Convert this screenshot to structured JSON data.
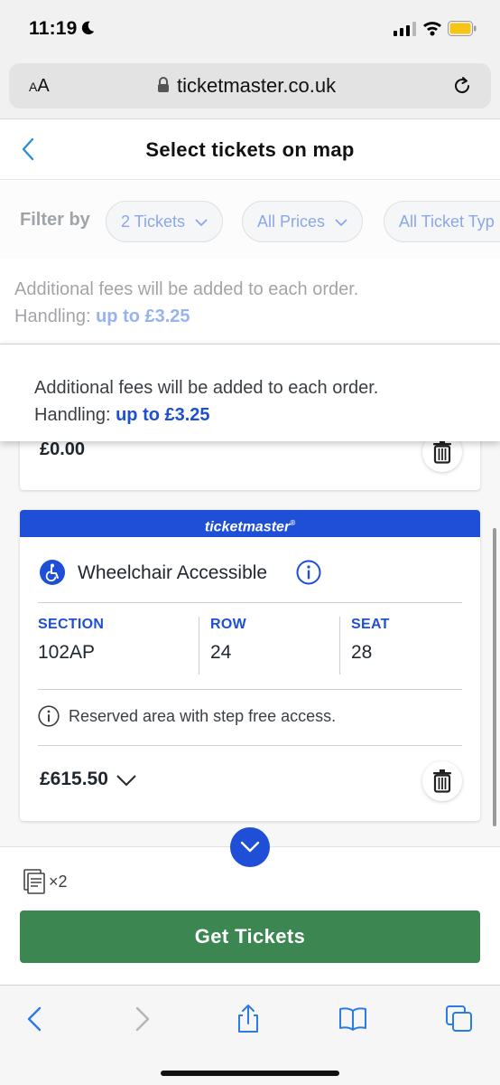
{
  "status_bar": {
    "time": "11:19"
  },
  "browser": {
    "text_size_label_small": "A",
    "text_size_label_large": "A",
    "url": "ticketmaster.co.uk"
  },
  "header": {
    "title": "Select tickets on map"
  },
  "filters": {
    "label": "Filter by",
    "chips": [
      "2 Tickets",
      "All Prices",
      "All Ticket Typ"
    ]
  },
  "fees_notice": {
    "line1": "Additional fees will be added to each order.",
    "handling_label": "Handling:",
    "handling_value": "up to £3.25"
  },
  "previous_ticket": {
    "price": "£0.00"
  },
  "ticket": {
    "brand": "ticketmaster",
    "brand_mark": "®",
    "type": "Wheelchair Accessible",
    "section_label": "SECTION",
    "section": "102AP",
    "row_label": "ROW",
    "row": "24",
    "seat_label": "SEAT",
    "seat": "28",
    "note": "Reserved area with step free access.",
    "price": "£615.50"
  },
  "footer": {
    "ticket_count": "×2",
    "cta": "Get Tickets"
  },
  "colors": {
    "brand_blue": "#1f4fd6",
    "cta_green": "#3b8651"
  },
  "icons": [
    "moon-icon",
    "signal-icon",
    "wifi-icon",
    "battery-icon",
    "lock-icon",
    "reload-icon",
    "back-chevron-icon",
    "chevron-down-icon",
    "trash-icon",
    "wheelchair-icon",
    "info-icon",
    "ticket-icon",
    "share-icon",
    "bookmarks-icon",
    "tabs-icon",
    "forward-icon"
  ]
}
